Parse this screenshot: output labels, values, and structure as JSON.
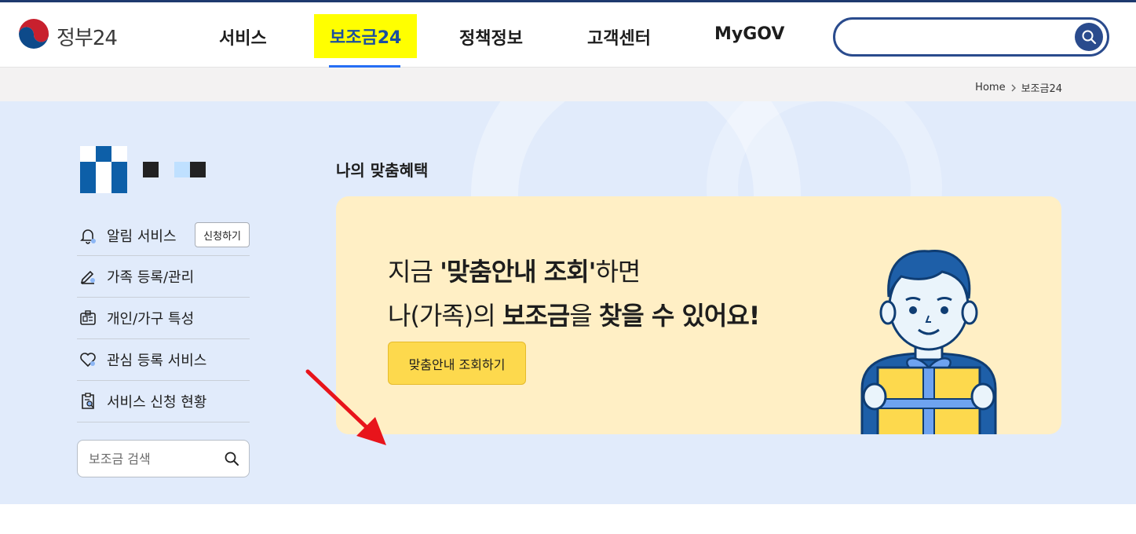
{
  "header": {
    "logo_text": "정부24",
    "nav": [
      {
        "label": "서비스"
      },
      {
        "label": "보조금24",
        "active": true
      },
      {
        "label": "정책정보"
      },
      {
        "label": "고객센터"
      },
      {
        "label": "MyGOV"
      }
    ],
    "search_placeholder": ""
  },
  "breadcrumb": {
    "home": "Home",
    "current": "보조금24"
  },
  "sidebar": {
    "items": [
      {
        "label": "알림 서비스",
        "icon": "bell-icon"
      },
      {
        "label": "가족 등록/관리",
        "icon": "edit-icon"
      },
      {
        "label": "개인/가구 특성",
        "icon": "id-card-icon"
      },
      {
        "label": "관심 등록 서비스",
        "icon": "heart-icon"
      },
      {
        "label": "서비스 신청 현황",
        "icon": "clipboard-search-icon"
      }
    ],
    "apply_button": "신청하기",
    "search_placeholder": "보조금 검색"
  },
  "main": {
    "section_title": "나의 맞춤혜택",
    "headline": {
      "line1_pre": "지금 ",
      "line1_bold": "'맞춤안내 조회'",
      "line1_post": "하면",
      "line2_a": "나(가족)의 ",
      "line2_b": "보조금",
      "line2_c": "을 ",
      "line2_d": "찾을 수 있어요!"
    },
    "cta_label": "맞춤안내 조회하기"
  },
  "colors": {
    "brand_navy": "#2a4b8d",
    "active_blue": "#256ef4",
    "highlight_yellow": "#ffff00",
    "card_bg": "#ffefc5",
    "cta_bg": "#fdd94d",
    "page_bg": "#e1ebfb",
    "annotation_arrow": "#e8141b"
  }
}
